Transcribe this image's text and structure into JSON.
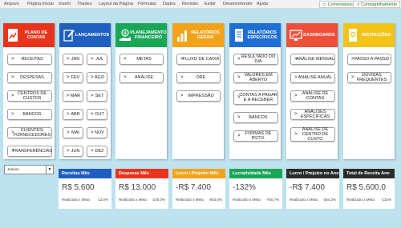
{
  "ribbon": {
    "tabs": [
      "Arquivo",
      "Página Inicial",
      "Inserir",
      "Thadeu",
      "Layout da Página",
      "Fórmulas",
      "Dados",
      "Revisão",
      "Exibir",
      "Desenvolvedor",
      "Ajuda"
    ],
    "comments_label": "Comentários",
    "share_label": "Compartilhamento"
  },
  "panels": {
    "plano": {
      "title": "Plano de Contas",
      "color": "#e8341c",
      "items": [
        "RECEITAS",
        "DESPESAS",
        "CENTROS DE CUSTOS",
        "BANCOS",
        "CLIENTES/ FORNECEDORES",
        "TRANSFERÊNCIAS"
      ]
    },
    "lancamentos": {
      "title": "Lançamentos",
      "color": "#1f5fbf",
      "months_left": [
        "JAN",
        "FEV",
        "MAR",
        "ABR",
        "MAI",
        "JUN"
      ],
      "months_right": [
        "JUL",
        "AGO",
        "SET",
        "OUT",
        "NOV",
        "DEZ"
      ]
    },
    "planejamento": {
      "title": "Planejamento Financeiro",
      "color": "#19a657",
      "items": [
        "METAS",
        "ANÁLISE"
      ]
    },
    "relgerais": {
      "title": "Relatórios Gerais",
      "color": "#f3a319",
      "items": [
        "FLUXO DE CAIXA",
        "DRE",
        "IMPRESSÃO"
      ]
    },
    "relespecificos": {
      "title": "Relatórios Específicos",
      "color": "#1f6ed4",
      "items": [
        "RESULTADO DO DIA",
        "VALORES EM ABERTO",
        "CONTAS A PAGAR E A RECEBER",
        "BANCOS",
        "FORMAS DE PGTO."
      ]
    },
    "dashboards": {
      "title": "Dashboards",
      "color": "#ee4f3a",
      "items": [
        "ANÁLISE MENSAL",
        "ANÁLISE ANUAL",
        "ANÁLISE DE CONTAS",
        "ANÁLISES ESPECÍFICAS",
        "ANÁLISE DE CENTRO DE CUSTO"
      ]
    },
    "instrucoes": {
      "title": "Instruções",
      "color": "#f2c318",
      "items": [
        "PASSO A PASSO",
        "DÚVIDAS FREQUENTES"
      ]
    }
  },
  "month_select": {
    "value": "Janeiro"
  },
  "kpis": [
    {
      "title": "Receitas Mês",
      "color": "#1f5fbf",
      "value": "R$ 5.600",
      "foot": "Realizado x Meta",
      "pct": "12,0%"
    },
    {
      "title": "Despesas Mês",
      "color": "#e8341c",
      "value": "R$ 13.000",
      "foot": "Realizado x Meta",
      "pct": "-225,0%"
    },
    {
      "title": "Lucro / Prejuízo Mês",
      "color": "#f3a319",
      "value": "-R$ 7.400",
      "foot": "Realizado x Meta",
      "pct": "-840,0%"
    },
    {
      "title": "Lucratividade Mês",
      "color": "#19a657",
      "value": "-132%",
      "foot": "Realizado x Meta",
      "pct": "-760,7%"
    },
    {
      "title": "Lucro / Prejuízo no Ano",
      "color": "#2b2b2b",
      "value": "-R$ 7.400",
      "foot": "Realizado x Meta",
      "pct": "-364,3%"
    },
    {
      "title": "Total de Receita Ano",
      "color": "#2b2b2b",
      "value": "R$ 5.600,0",
      "foot": "Realizado x Meta",
      "pct": "-132%"
    }
  ]
}
